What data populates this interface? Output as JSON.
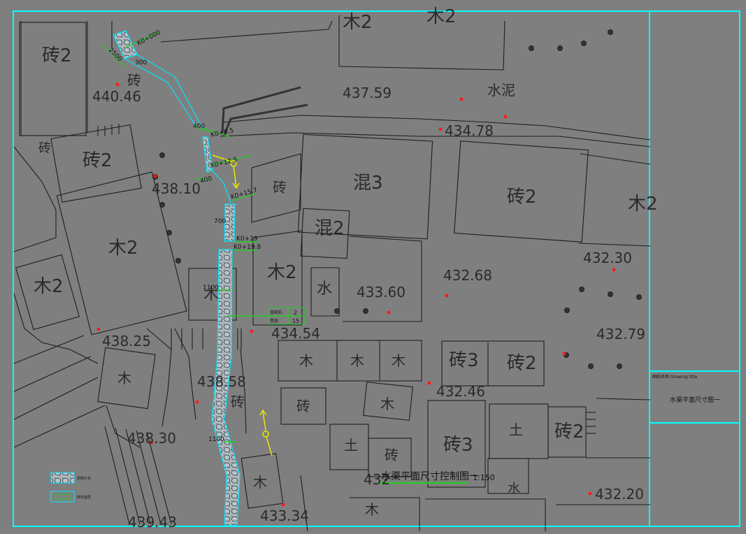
{
  "drawing": {
    "title_label": "水渠平面尺寸控制图一",
    "scale": "1:150",
    "titleblock_name_label": "图纸名称 Drawing title",
    "titleblock_name": "水渠平面尺寸图一"
  },
  "legend": {
    "item1": "浆砌片石",
    "item2": "碎石垫层"
  },
  "stations": {
    "k0": "K0+000",
    "k9": "K0+9.5",
    "k12": "K0+12.5",
    "k15": "K0+15.7",
    "k19": "K0+19",
    "k198": "K0+19.8"
  },
  "dims": {
    "d2500": "2500",
    "d300": "300",
    "d400a": "400",
    "d400b": "400",
    "d700": "700",
    "d1100a": "1100",
    "d1100b": "1100"
  },
  "table": {
    "row1_label": "浆砌石",
    "row1_val": "2",
    "row2_label": "垫层",
    "row2_val": "15"
  },
  "elevations": {
    "e1": "440.46",
    "e2": "437.59",
    "e3": "434.78",
    "e4": "438.10",
    "e5": "432.30",
    "e6": "432.68",
    "e7": "433.60",
    "e8": "432.79",
    "e9": "438.25",
    "e10": "434.54",
    "e11": "432.46",
    "e12": "438.58",
    "e13": "438.30",
    "e14": "432.20",
    "e15": "439.43",
    "e16": "433.34",
    "e17": "432"
  },
  "buildings": {
    "b1": "砖2",
    "b2": "木2",
    "b3": "木2",
    "b4": "砖",
    "b5": "砖2",
    "b6": "木2",
    "b7": "木2",
    "b8": "砖",
    "b9": "混3",
    "b10": "砖2",
    "b11": "木2",
    "b12": "混2",
    "b13": "木2",
    "b14": "水",
    "b15": "木",
    "b16": "木",
    "b17": "木",
    "b18": "木",
    "b19": "砖3",
    "b20": "砖2",
    "b21": "木",
    "b22": "砖",
    "b23": "木",
    "b24": "砖",
    "b25": "土",
    "b26": "砖",
    "b27": "砖3",
    "b28": "土",
    "b29": "砖2",
    "b30": "木",
    "b31": "木",
    "b32": "水",
    "b33": "砖"
  },
  "area_label": "水泥"
}
